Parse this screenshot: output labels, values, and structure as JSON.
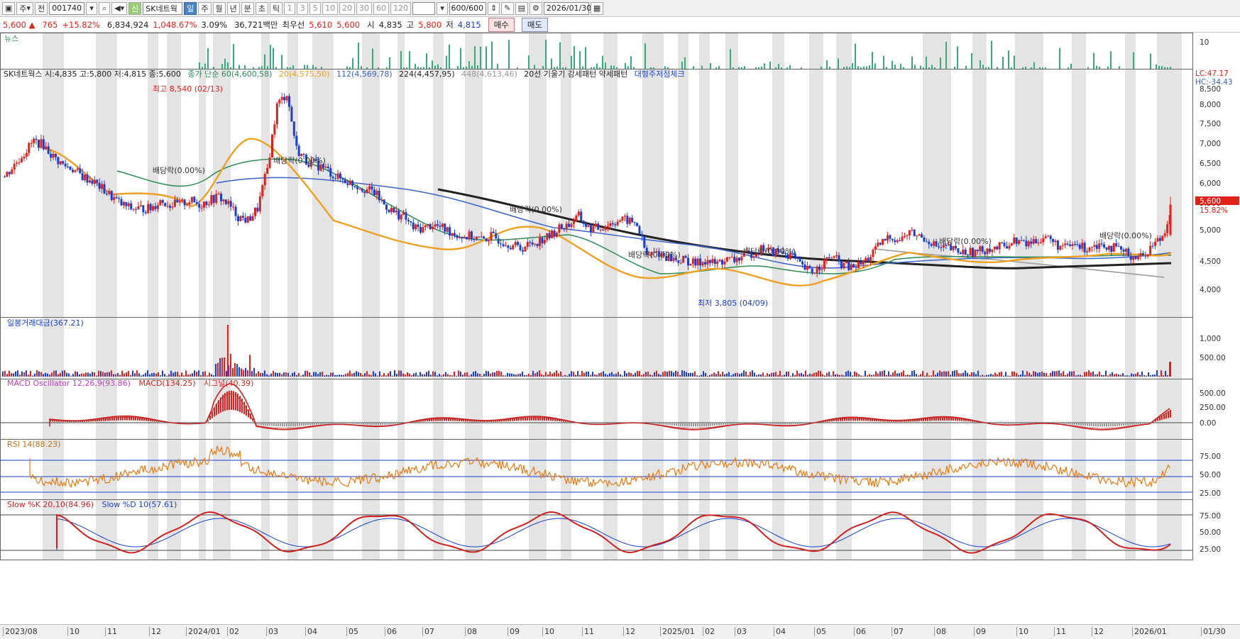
{
  "toolbar": {
    "toggle_label": "주",
    "market_label": "전",
    "stock_code": "001740",
    "stock_name": "SK네트웍",
    "period_buttons": [
      "일",
      "주",
      "월",
      "년",
      "분",
      "초",
      "틱"
    ],
    "minute_buttons": [
      "1",
      "3",
      "5",
      "10",
      "20",
      "30",
      "60",
      "120"
    ],
    "count_value": "600",
    "count_total": "/600",
    "date": "2026/01/30"
  },
  "quote": {
    "price": "5,600 ▲",
    "change": "765",
    "change_pct": "+15.82%",
    "volume": "6,834,924",
    "volume_ratio": "1,048.67%",
    "turnover": "3.09%",
    "amount": "36,721백만",
    "best_label": "최우선",
    "ask": "5,610",
    "bid": "5,600",
    "open_label": "시",
    "open": "4,835",
    "high_label": "고",
    "high": "5,800",
    "low_label": "저",
    "low": "4,815",
    "buy_button": "매수",
    "sell_button": "매도"
  },
  "panels": {
    "news": {
      "title": "뉴스",
      "axis": [
        "10"
      ]
    },
    "price": {
      "legend": [
        {
          "text": "SK네트웍스 시:4,835 고:5,800 저:4,815 종:5,600",
          "color": "#222222"
        },
        {
          "text": "종가 단순 60(4,600,58)",
          "color": "#2e8b57"
        },
        {
          "text": "20(4,575,50)",
          "color": "#f0a020"
        },
        {
          "text": "112(4,569,78)",
          "color": "#3a63c9"
        },
        {
          "text": "224(4,457,95)",
          "color": "#222222"
        },
        {
          "text": "448(4,613,46)",
          "color": "#999999"
        },
        {
          "text": "20선 기울기 강세패턴  약세패턴",
          "color": "#222222"
        },
        {
          "text": "대형주저점체크",
          "color": "#1a3fd0"
        }
      ],
      "axis": [
        "8,500",
        "8,000",
        "7,500",
        "7,000",
        "6,500",
        "6,000",
        "5,500",
        "5,000",
        "4,500",
        "4,000"
      ],
      "lc": "LC:47.17",
      "hc": "HC:-34.43",
      "current_price_tag": "5,600",
      "current_pct": "15.82%",
      "high_note": "최고 8,540 (02/13)",
      "low_note": "최저 3,805 (04/09)",
      "dividend_label": "배당락(0.00%)"
    },
    "amount": {
      "title": "일봉거래대금(367.21)",
      "axis": [
        "1,000",
        "500.00"
      ]
    },
    "macd": {
      "title_a": "MACD Oscillator 12,26,9(93.86)",
      "title_b": "MACD(134.25)",
      "title_c": "시그널(40.39)",
      "axis": [
        "500.00",
        "250.00",
        "0.00"
      ]
    },
    "rsi": {
      "title": "RSI 14(88.23)",
      "axis": [
        "75.00",
        "50.00",
        "25.00"
      ]
    },
    "stoch": {
      "title_a": "Slow %K 20,10(84.96)",
      "title_b": "Slow %D 10(57.61)",
      "axis": [
        "75.00",
        "50.00",
        "25.00"
      ]
    }
  },
  "x_axis": [
    "2023/08",
    "10",
    "11",
    "12",
    "2024/01",
    "02",
    "03",
    "04",
    "05",
    "06",
    "07",
    "08",
    "09",
    "10",
    "11",
    "12",
    "2025/01",
    "02",
    "03",
    "04",
    "05",
    "06",
    "07",
    "08",
    "09",
    "10",
    "11",
    "12",
    "2026/01",
    "01/30"
  ],
  "colors": {
    "up": "#e0201a",
    "down": "#1a3fd0",
    "ma20": "#f0a020",
    "ma60": "#2e8b57",
    "ma112": "#3a63c9",
    "ma224": "#222222",
    "ma448": "#999999"
  },
  "price_series": [
    6.3,
    6.6,
    6.9,
    7.2,
    7.1,
    6.8,
    6.6,
    6.5,
    6.3,
    6.2,
    6.0,
    5.8,
    5.6,
    5.5,
    5.5,
    5.5,
    5.7,
    5.6,
    5.6,
    5.7,
    5.6,
    5.7,
    5.8,
    5.6,
    5.3,
    5.2,
    5.5,
    6.5,
    8.1,
    8.4,
    7.0,
    6.7,
    6.6,
    6.5,
    6.3,
    6.2,
    6.1,
    6.0,
    5.9,
    5.6,
    5.4,
    5.3,
    5.0,
    5.0,
    5.1,
    5.0,
    4.9,
    4.8,
    4.8,
    4.7,
    4.8,
    4.7,
    4.6,
    4.5,
    4.6,
    4.7,
    4.8,
    5.0,
    5.1,
    5.3,
    5.0,
    5.0,
    5.1,
    5.2,
    5.2,
    5.1,
    4.3,
    4.4,
    4.3,
    4.2,
    4.2,
    4.1,
    4.2,
    4.1,
    4.2,
    4.2,
    4.3,
    4.4,
    4.5,
    4.4,
    4.4,
    4.3,
    4.0,
    3.9,
    4.1,
    4.3,
    4.1,
    4.0,
    4.1,
    4.3,
    4.6,
    4.8,
    4.7,
    4.9,
    4.8,
    4.7,
    4.5,
    4.5,
    4.4,
    4.4,
    4.4,
    4.5,
    4.5,
    4.6,
    4.7,
    4.6,
    4.7,
    4.8,
    4.6,
    4.5,
    4.6,
    4.5,
    4.6,
    4.6,
    4.5,
    4.4,
    4.3,
    4.3,
    4.6,
    4.8,
    5.6
  ]
}
